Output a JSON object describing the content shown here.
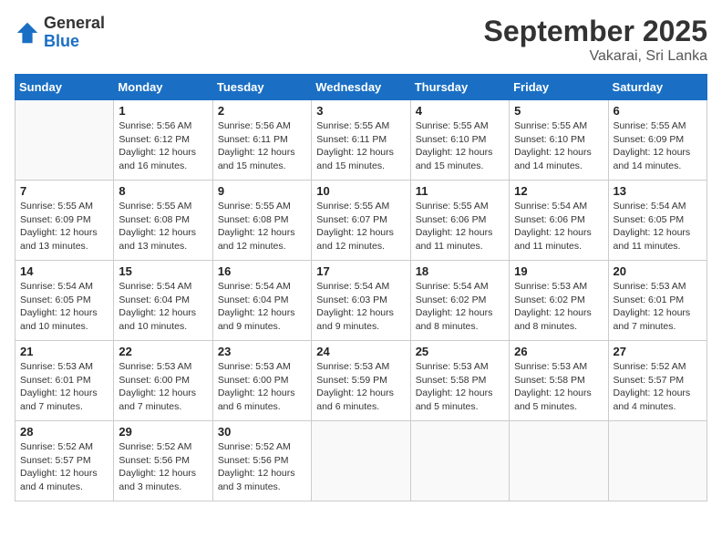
{
  "logo": {
    "general": "General",
    "blue": "Blue"
  },
  "header": {
    "month": "September 2025",
    "location": "Vakarai, Sri Lanka"
  },
  "weekdays": [
    "Sunday",
    "Monday",
    "Tuesday",
    "Wednesday",
    "Thursday",
    "Friday",
    "Saturday"
  ],
  "weeks": [
    [
      {
        "day": "",
        "info": ""
      },
      {
        "day": "1",
        "info": "Sunrise: 5:56 AM\nSunset: 6:12 PM\nDaylight: 12 hours\nand 16 minutes."
      },
      {
        "day": "2",
        "info": "Sunrise: 5:56 AM\nSunset: 6:11 PM\nDaylight: 12 hours\nand 15 minutes."
      },
      {
        "day": "3",
        "info": "Sunrise: 5:55 AM\nSunset: 6:11 PM\nDaylight: 12 hours\nand 15 minutes."
      },
      {
        "day": "4",
        "info": "Sunrise: 5:55 AM\nSunset: 6:10 PM\nDaylight: 12 hours\nand 15 minutes."
      },
      {
        "day": "5",
        "info": "Sunrise: 5:55 AM\nSunset: 6:10 PM\nDaylight: 12 hours\nand 14 minutes."
      },
      {
        "day": "6",
        "info": "Sunrise: 5:55 AM\nSunset: 6:09 PM\nDaylight: 12 hours\nand 14 minutes."
      }
    ],
    [
      {
        "day": "7",
        "info": "Sunrise: 5:55 AM\nSunset: 6:09 PM\nDaylight: 12 hours\nand 13 minutes."
      },
      {
        "day": "8",
        "info": "Sunrise: 5:55 AM\nSunset: 6:08 PM\nDaylight: 12 hours\nand 13 minutes."
      },
      {
        "day": "9",
        "info": "Sunrise: 5:55 AM\nSunset: 6:08 PM\nDaylight: 12 hours\nand 12 minutes."
      },
      {
        "day": "10",
        "info": "Sunrise: 5:55 AM\nSunset: 6:07 PM\nDaylight: 12 hours\nand 12 minutes."
      },
      {
        "day": "11",
        "info": "Sunrise: 5:55 AM\nSunset: 6:06 PM\nDaylight: 12 hours\nand 11 minutes."
      },
      {
        "day": "12",
        "info": "Sunrise: 5:54 AM\nSunset: 6:06 PM\nDaylight: 12 hours\nand 11 minutes."
      },
      {
        "day": "13",
        "info": "Sunrise: 5:54 AM\nSunset: 6:05 PM\nDaylight: 12 hours\nand 11 minutes."
      }
    ],
    [
      {
        "day": "14",
        "info": "Sunrise: 5:54 AM\nSunset: 6:05 PM\nDaylight: 12 hours\nand 10 minutes."
      },
      {
        "day": "15",
        "info": "Sunrise: 5:54 AM\nSunset: 6:04 PM\nDaylight: 12 hours\nand 10 minutes."
      },
      {
        "day": "16",
        "info": "Sunrise: 5:54 AM\nSunset: 6:04 PM\nDaylight: 12 hours\nand 9 minutes."
      },
      {
        "day": "17",
        "info": "Sunrise: 5:54 AM\nSunset: 6:03 PM\nDaylight: 12 hours\nand 9 minutes."
      },
      {
        "day": "18",
        "info": "Sunrise: 5:54 AM\nSunset: 6:02 PM\nDaylight: 12 hours\nand 8 minutes."
      },
      {
        "day": "19",
        "info": "Sunrise: 5:53 AM\nSunset: 6:02 PM\nDaylight: 12 hours\nand 8 minutes."
      },
      {
        "day": "20",
        "info": "Sunrise: 5:53 AM\nSunset: 6:01 PM\nDaylight: 12 hours\nand 7 minutes."
      }
    ],
    [
      {
        "day": "21",
        "info": "Sunrise: 5:53 AM\nSunset: 6:01 PM\nDaylight: 12 hours\nand 7 minutes."
      },
      {
        "day": "22",
        "info": "Sunrise: 5:53 AM\nSunset: 6:00 PM\nDaylight: 12 hours\nand 7 minutes."
      },
      {
        "day": "23",
        "info": "Sunrise: 5:53 AM\nSunset: 6:00 PM\nDaylight: 12 hours\nand 6 minutes."
      },
      {
        "day": "24",
        "info": "Sunrise: 5:53 AM\nSunset: 5:59 PM\nDaylight: 12 hours\nand 6 minutes."
      },
      {
        "day": "25",
        "info": "Sunrise: 5:53 AM\nSunset: 5:58 PM\nDaylight: 12 hours\nand 5 minutes."
      },
      {
        "day": "26",
        "info": "Sunrise: 5:53 AM\nSunset: 5:58 PM\nDaylight: 12 hours\nand 5 minutes."
      },
      {
        "day": "27",
        "info": "Sunrise: 5:52 AM\nSunset: 5:57 PM\nDaylight: 12 hours\nand 4 minutes."
      }
    ],
    [
      {
        "day": "28",
        "info": "Sunrise: 5:52 AM\nSunset: 5:57 PM\nDaylight: 12 hours\nand 4 minutes."
      },
      {
        "day": "29",
        "info": "Sunrise: 5:52 AM\nSunset: 5:56 PM\nDaylight: 12 hours\nand 3 minutes."
      },
      {
        "day": "30",
        "info": "Sunrise: 5:52 AM\nSunset: 5:56 PM\nDaylight: 12 hours\nand 3 minutes."
      },
      {
        "day": "",
        "info": ""
      },
      {
        "day": "",
        "info": ""
      },
      {
        "day": "",
        "info": ""
      },
      {
        "day": "",
        "info": ""
      }
    ]
  ]
}
